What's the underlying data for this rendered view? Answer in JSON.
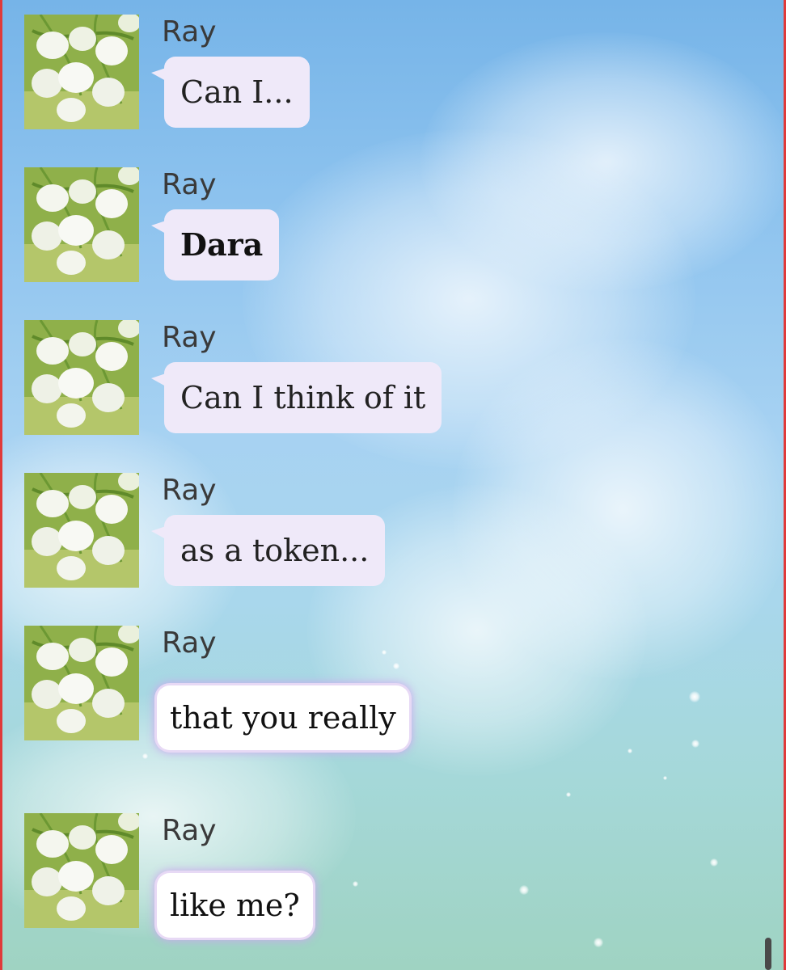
{
  "chat": {
    "messages": [
      {
        "sender": "Ray",
        "text": "Can I...",
        "avatar_icon": "lily-of-the-valley-avatar"
      },
      {
        "sender": "Ray",
        "text": "Dara",
        "avatar_icon": "lily-of-the-valley-avatar"
      },
      {
        "sender": "Ray",
        "text": "Can I think of it",
        "avatar_icon": "lily-of-the-valley-avatar"
      },
      {
        "sender": "Ray",
        "text": "as a token...",
        "avatar_icon": "lily-of-the-valley-avatar"
      },
      {
        "sender": "Ray",
        "text": "that you really",
        "avatar_icon": "lily-of-the-valley-avatar"
      },
      {
        "sender": "Ray",
        "text": "like me?",
        "avatar_icon": "lily-of-the-valley-avatar"
      }
    ]
  },
  "colors": {
    "bubble": "#efe9f9",
    "bubble_glow": "#cbaaee",
    "sky_top": "#76b4e8",
    "sky_bottom": "#9fd3c2",
    "edge": "#e03a3a"
  }
}
